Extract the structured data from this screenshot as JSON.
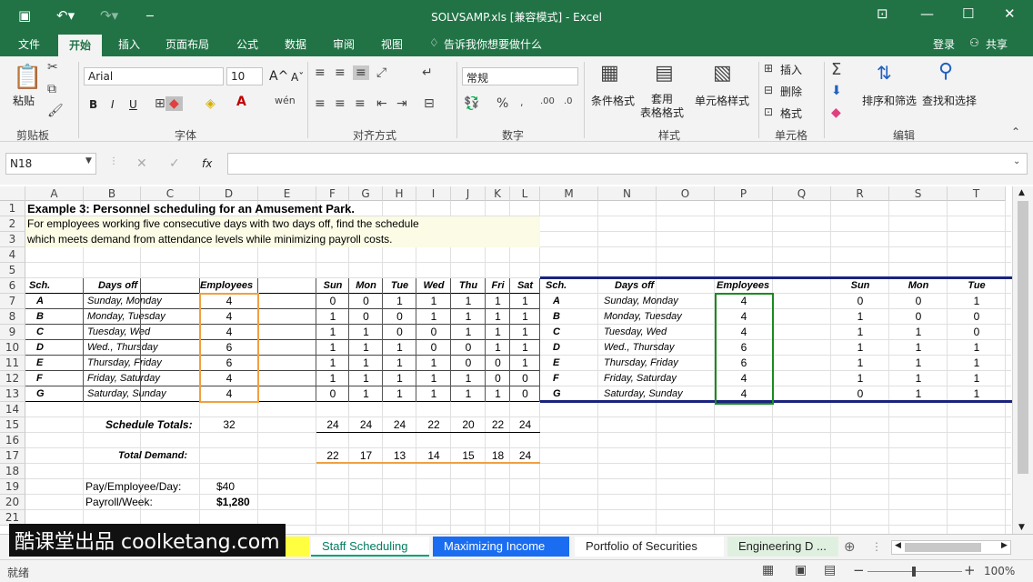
{
  "window": {
    "title": "SOLVSAMP.xls [兼容模式] - Excel"
  },
  "menu": {
    "file": "文件",
    "home": "开始",
    "insert": "插入",
    "page_layout": "页面布局",
    "formulas": "公式",
    "data": "数据",
    "review": "审阅",
    "view": "视图",
    "tell_me": "告诉我你想要做什么",
    "login": "登录",
    "share": "共享"
  },
  "ribbon": {
    "paste": "粘贴",
    "clipboard": "剪贴板",
    "font_name": "Arial",
    "font_size": "10",
    "font_group": "字体",
    "bold": "B",
    "italic": "I",
    "underline": "U",
    "align_group": "对齐方式",
    "number_format": "常规",
    "number_group": "数字",
    "cond_format": "条件格式",
    "table_format": "套用\n表格格式",
    "cell_styles": "单元格样式",
    "styles_group": "样式",
    "insert": "插入",
    "delete": "删除",
    "format": "格式",
    "cells_group": "单元格",
    "sort_filter": "排序和筛选",
    "find_select": "查找和选择",
    "editing_group": "编辑"
  },
  "formula_bar": {
    "name_box": "N18",
    "fx": "fx",
    "value": ""
  },
  "columns": [
    "A",
    "B",
    "C",
    "D",
    "E",
    "F",
    "G",
    "H",
    "I",
    "J",
    "K",
    "L",
    "M",
    "N",
    "O",
    "P",
    "Q",
    "R",
    "S",
    "T"
  ],
  "rows": [
    "1",
    "2",
    "3",
    "4",
    "5",
    "6",
    "7",
    "8",
    "9",
    "10",
    "11",
    "12",
    "13",
    "14",
    "15",
    "16",
    "17",
    "18",
    "19",
    "20",
    "21"
  ],
  "sheet": {
    "title": "Example 3:  Personnel scheduling for an Amusement Park.",
    "desc1": "For employees working five consecutive days with two days off, find the schedule",
    "desc2": "which meets demand from attendance levels while minimizing payroll costs.",
    "hdr": {
      "sch": "Sch.",
      "days_off": "Days off",
      "employees": "Employees",
      "sun": "Sun",
      "mon": "Mon",
      "tue": "Tue",
      "wed": "Wed",
      "thu": "Thu",
      "fri": "Fri",
      "sat": "Sat"
    },
    "schedule": [
      {
        "sch": "A",
        "days": "Sunday, Monday",
        "emp": "4",
        "d": [
          "0",
          "0",
          "1",
          "1",
          "1",
          "1",
          "1"
        ]
      },
      {
        "sch": "B",
        "days": "Monday, Tuesday",
        "emp": "4",
        "d": [
          "1",
          "0",
          "0",
          "1",
          "1",
          "1",
          "1"
        ]
      },
      {
        "sch": "C",
        "days": "Tuesday, Wed",
        "emp": "4",
        "d": [
          "1",
          "1",
          "0",
          "0",
          "1",
          "1",
          "1"
        ]
      },
      {
        "sch": "D",
        "days": "Wed., Thursday",
        "emp": "6",
        "d": [
          "1",
          "1",
          "1",
          "0",
          "0",
          "1",
          "1"
        ]
      },
      {
        "sch": "E",
        "days": "Thursday, Friday",
        "emp": "6",
        "d": [
          "1",
          "1",
          "1",
          "1",
          "0",
          "0",
          "1"
        ]
      },
      {
        "sch": "F",
        "days": "Friday, Saturday",
        "emp": "4",
        "d": [
          "1",
          "1",
          "1",
          "1",
          "1",
          "0",
          "0"
        ]
      },
      {
        "sch": "G",
        "days": "Saturday, Sunday",
        "emp": "4",
        "d": [
          "0",
          "1",
          "1",
          "1",
          "1",
          "1",
          "0"
        ]
      }
    ],
    "totals_label": "Schedule Totals:",
    "totals_emp": "32",
    "totals": [
      "24",
      "24",
      "24",
      "22",
      "20",
      "22",
      "24"
    ],
    "demand_label": "Total Demand:",
    "demand": [
      "22",
      "17",
      "13",
      "14",
      "15",
      "18",
      "24"
    ],
    "pay_label": "Pay/Employee/Day:",
    "pay_value": "$40",
    "payroll_label": "Payroll/Week:",
    "payroll_value": "$1,280"
  },
  "tabs": [
    "Staff Scheduling",
    "Maximizing Income",
    "Portfolio of Securities",
    "Engineering D ..."
  ],
  "watermark": "酷课堂出品 coolketang.com",
  "status": {
    "ready": "就绪",
    "zoom": "100%"
  }
}
